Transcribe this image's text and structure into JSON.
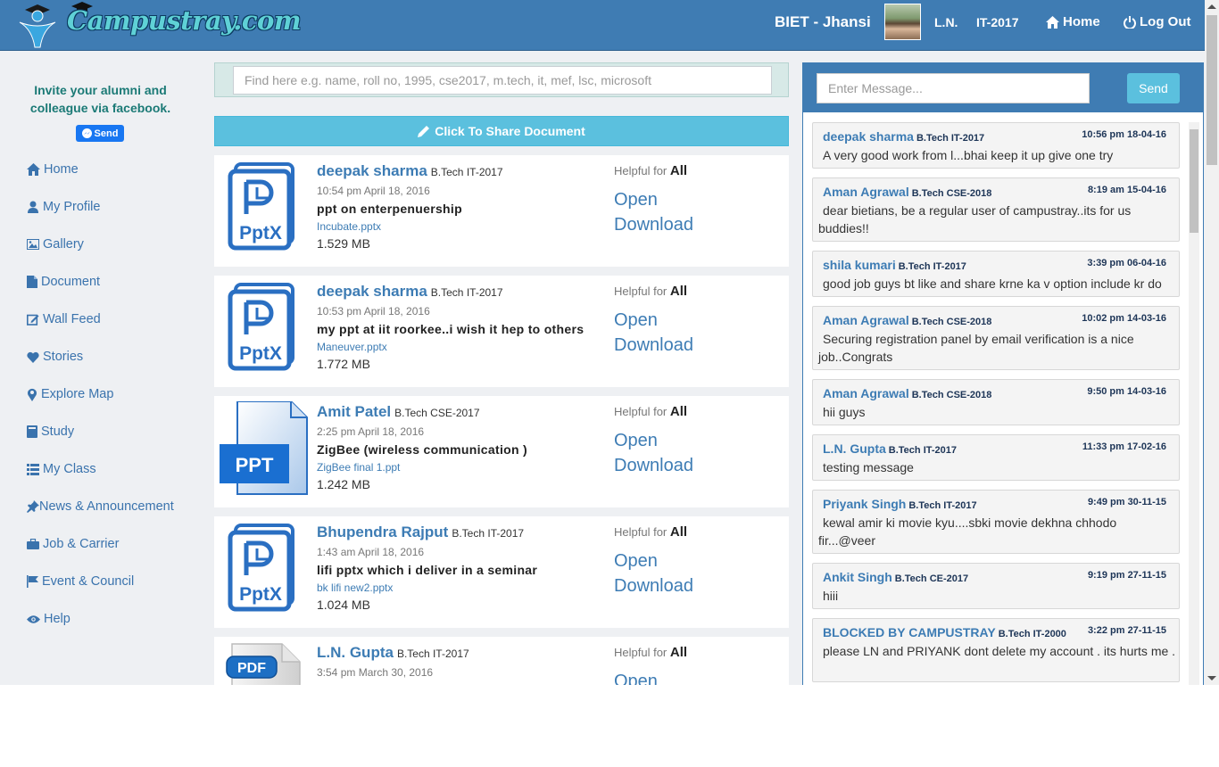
{
  "brand": {
    "name": "Campustray.com"
  },
  "navbar": {
    "college": "BIET - Jhansi",
    "user": "L.N.",
    "batch": "IT-2017",
    "home_label": "Home",
    "logout_label": "Log Out"
  },
  "sidebar": {
    "invite_text": "Invite your alumni and colleague via facebook.",
    "fb_send_label": "Send",
    "items": [
      {
        "label": "Home",
        "icon": "home-icon"
      },
      {
        "label": "My Profile",
        "icon": "user-icon"
      },
      {
        "label": "Gallery",
        "icon": "picture-icon"
      },
      {
        "label": "Document",
        "icon": "file-icon"
      },
      {
        "label": "Wall Feed",
        "icon": "edit-icon"
      },
      {
        "label": "Stories",
        "icon": "heart-icon"
      },
      {
        "label": "Explore Map",
        "icon": "map-marker-icon"
      },
      {
        "label": "Study",
        "icon": "book-icon"
      },
      {
        "label": "My Class",
        "icon": "list-icon"
      },
      {
        "label": "News & Announcement",
        "icon": "pushpin-icon"
      },
      {
        "label": "Job & Carrier",
        "icon": "briefcase-icon"
      },
      {
        "label": "Event & Council",
        "icon": "flag-icon"
      },
      {
        "label": "Help",
        "icon": "eye-icon"
      }
    ]
  },
  "search": {
    "placeholder": "Find here e.g. name, roll no, 1995, cse2017, m.tech, it, mef, lsc, microsoft"
  },
  "share": {
    "label": "Click To Share Document"
  },
  "documents": [
    {
      "author": "deepak sharma",
      "batch": "B.Tech IT-2017",
      "time": "10:54 pm April 18, 2016",
      "title": "ppt on enterpenuership",
      "file": "Incubate.pptx",
      "size": "1.529 MB",
      "helpful_prefix": "Helpful for",
      "helpful_for": "All",
      "open": "Open",
      "download": "Download",
      "icon": "pptx-icon"
    },
    {
      "author": "deepak sharma",
      "batch": "B.Tech IT-2017",
      "time": "10:53 pm April 18, 2016",
      "title": "my ppt at iit roorkee..i wish it hep to others",
      "file": "Maneuver.pptx",
      "size": "1.772 MB",
      "helpful_prefix": "Helpful for",
      "helpful_for": "All",
      "open": "Open",
      "download": "Download",
      "icon": "pptx-icon"
    },
    {
      "author": "Amit Patel",
      "batch": "B.Tech CSE-2017",
      "time": "2:25 pm April 18, 2016",
      "title": "ZigBee (wireless communication )",
      "file": "ZigBee final 1.ppt",
      "size": "1.242 MB",
      "helpful_prefix": "Helpful for",
      "helpful_for": "All",
      "open": "Open",
      "download": "Download",
      "icon": "ppt-icon",
      "icon_label": "PPT"
    },
    {
      "author": "Bhupendra Rajput",
      "batch": "B.Tech IT-2017",
      "time": "1:43 am April 18, 2016",
      "title": "lifi pptx which i deliver in a seminar",
      "file": "bk lifi new2.pptx",
      "size": "1.024 MB",
      "helpful_prefix": "Helpful for",
      "helpful_for": "All",
      "open": "Open",
      "download": "Download",
      "icon": "pptx-icon"
    },
    {
      "author": "L.N. Gupta",
      "batch": "B.Tech IT-2017",
      "time": "3:54 pm March 30, 2016",
      "title": "",
      "file": "",
      "size": "",
      "helpful_prefix": "Helpful for",
      "helpful_for": "All",
      "open": "Open",
      "download": "",
      "icon": "pdf-icon",
      "icon_label": "PDF"
    }
  ],
  "chat": {
    "placeholder": "Enter Message...",
    "send_label": "Send",
    "messages": [
      {
        "name": "deepak sharma",
        "batch": "B.Tech IT-2017",
        "time": "10:56 pm 18-04-16",
        "text": "A very good work from l...bhai keep it up give one try"
      },
      {
        "name": "Aman Agrawal",
        "batch": "B.Tech CSE-2018",
        "time": "8:19 am 15-04-16",
        "text": "dear bietians, be a regular user of campustray..its for us buddies!!"
      },
      {
        "name": "shila kumari",
        "batch": "B.Tech IT-2017",
        "time": "3:39 pm 06-04-16",
        "text": "good job guys bt like and share krne ka v option include kr do"
      },
      {
        "name": "Aman Agrawal",
        "batch": "B.Tech CSE-2018",
        "time": "10:02 pm 14-03-16",
        "text": "Securing registration panel by email verification is a nice job..Congrats"
      },
      {
        "name": "Aman Agrawal",
        "batch": "B.Tech CSE-2018",
        "time": "9:50 pm 14-03-16",
        "text": "hii guys"
      },
      {
        "name": "L.N. Gupta",
        "batch": "B.Tech IT-2017",
        "time": "11:33 pm 17-02-16",
        "text": "testing message"
      },
      {
        "name": "Priyank Singh",
        "batch": "B.Tech IT-2017",
        "time": "9:49 pm 30-11-15",
        "text": "kewal amir ki movie kyu....sbki movie dekhna chhodo fir...@veer"
      },
      {
        "name": "Ankit Singh",
        "batch": "B.Tech CE-2017",
        "time": "9:19 pm 27-11-15",
        "text": "hiii"
      },
      {
        "name": "BLOCKED BY CAMPUSTRAY",
        "batch": "B.Tech IT-2000",
        "time": "3:22 pm 27-11-15",
        "text": "please LN and PRIYANK dont delete my account . its hurts me ."
      }
    ]
  },
  "colors": {
    "brand_blue": "#3f7cb3",
    "accent_cyan": "#5bc0de",
    "link_blue": "#3d7cb4"
  }
}
